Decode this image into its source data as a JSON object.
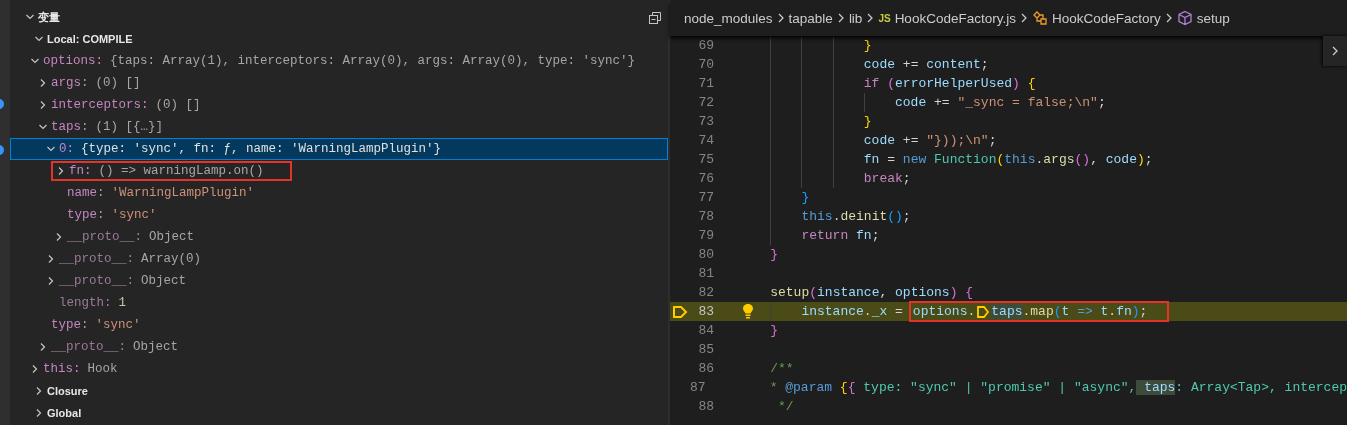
{
  "variables": {
    "tree": [
      {
        "kind": "section",
        "label": "变量",
        "expanded": true,
        "children": [
          {
            "kind": "scope",
            "label": "Local: COMPILE",
            "expanded": true,
            "children": [
              {
                "kind": "object",
                "name": "options:",
                "value": "{taps: Array(1), interceptors: Array(0), args: Array(0), type: 'sync'}",
                "dimmed": false,
                "expanded": true,
                "selected": false,
                "boxed": false,
                "children": [
                  {
                    "kind": "object",
                    "name": "args:",
                    "value": "(0) []",
                    "dimmed": false,
                    "expanded": false,
                    "selected": false,
                    "boxed": false
                  },
                  {
                    "kind": "object",
                    "name": "interceptors:",
                    "value": "(0) []",
                    "dimmed": false,
                    "expanded": false,
                    "selected": false,
                    "boxed": false
                  },
                  {
                    "kind": "object",
                    "name": "taps:",
                    "value": "(1) [{…}]",
                    "dimmed": false,
                    "expanded": true,
                    "selected": false,
                    "boxed": false,
                    "children": [
                      {
                        "kind": "entry",
                        "name": "0:",
                        "value": "{type: 'sync', fn: ƒ, name: 'WarningLampPlugin'}",
                        "dimmed": false,
                        "expanded": true,
                        "selected": true,
                        "boxed": false,
                        "children": [
                          {
                            "kind": "object",
                            "name": "fn:",
                            "value": "() => warningLamp.on()",
                            "dimmed": false,
                            "expanded": false,
                            "selected": false,
                            "boxed": true
                          },
                          {
                            "kind": "string",
                            "name": "name:",
                            "value": "'WarningLampPlugin'",
                            "dimmed": false,
                            "selected": false,
                            "boxed": false
                          },
                          {
                            "kind": "string",
                            "name": "type:",
                            "value": "'sync'",
                            "dimmed": false,
                            "selected": false,
                            "boxed": false
                          },
                          {
                            "kind": "object",
                            "name": "__proto__:",
                            "value": "Object",
                            "dimmed": true,
                            "expanded": false,
                            "selected": false,
                            "boxed": false
                          }
                        ]
                      },
                      {
                        "kind": "object",
                        "name": "__proto__:",
                        "value": "Array(0)",
                        "dimmed": true,
                        "expanded": false,
                        "selected": false,
                        "boxed": false
                      },
                      {
                        "kind": "object",
                        "name": "__proto__:",
                        "value": "Object",
                        "dimmed": true,
                        "expanded": false,
                        "selected": false,
                        "boxed": false
                      },
                      {
                        "kind": "number",
                        "name": "length:",
                        "value": "1",
                        "dimmed": true,
                        "selected": false,
                        "boxed": false
                      }
                    ]
                  },
                  {
                    "kind": "string",
                    "name": "type:",
                    "value": "'sync'",
                    "dimmed": false,
                    "selected": false,
                    "boxed": false
                  },
                  {
                    "kind": "object",
                    "name": "__proto__:",
                    "value": "Object",
                    "dimmed": true,
                    "expanded": false,
                    "selected": false,
                    "boxed": false
                  }
                ]
              },
              {
                "kind": "object",
                "name": "this:",
                "value": "Hook",
                "dimmed": false,
                "expanded": false,
                "selected": false,
                "boxed": false
              }
            ]
          },
          {
            "kind": "scope",
            "label": "Closure",
            "expanded": false
          },
          {
            "kind": "scope",
            "label": "Global",
            "expanded": false
          }
        ]
      }
    ]
  },
  "editor": {
    "breadcrumb": [
      {
        "kind": "folder",
        "label": "node_modules"
      },
      {
        "kind": "folder",
        "label": "tapable"
      },
      {
        "kind": "folder",
        "label": "lib"
      },
      {
        "kind": "file",
        "badge": "JS",
        "label": "HookCodeFactory.js"
      },
      {
        "kind": "class",
        "label": "HookCodeFactory"
      },
      {
        "kind": "method",
        "label": "setup"
      }
    ],
    "lines": [
      {
        "number": "69",
        "current": false,
        "tokens": [
          {
            "kind": "br1",
            "t": "                }"
          }
        ]
      },
      {
        "number": "70",
        "current": false,
        "tokens": [
          {
            "kind": "var",
            "t": "                code"
          },
          {
            "kind": "punc",
            "t": " += "
          },
          {
            "kind": "var",
            "t": "content"
          },
          {
            "kind": "punc",
            "t": ";"
          }
        ]
      },
      {
        "number": "71",
        "current": false,
        "tokens": [
          {
            "kind": "kw",
            "t": "                if"
          },
          {
            "kind": "br2",
            "t": " ("
          },
          {
            "kind": "var",
            "t": "errorHelperUsed"
          },
          {
            "kind": "br2",
            "t": ")"
          },
          {
            "kind": "br1",
            "t": " {"
          }
        ]
      },
      {
        "number": "72",
        "current": false,
        "tokens": [
          {
            "kind": "var",
            "t": "                    code"
          },
          {
            "kind": "punc",
            "t": " += "
          },
          {
            "kind": "str",
            "t": "\"_sync = false;\\n\""
          },
          {
            "kind": "punc",
            "t": ";"
          }
        ]
      },
      {
        "number": "73",
        "current": false,
        "tokens": [
          {
            "kind": "br1",
            "t": "                }"
          }
        ]
      },
      {
        "number": "74",
        "current": false,
        "tokens": [
          {
            "kind": "var",
            "t": "                code"
          },
          {
            "kind": "punc",
            "t": " += "
          },
          {
            "kind": "str",
            "t": "\"}));\\n\""
          },
          {
            "kind": "punc",
            "t": ";"
          }
        ]
      },
      {
        "number": "75",
        "current": false,
        "tokens": [
          {
            "kind": "var",
            "t": "                fn"
          },
          {
            "kind": "punc",
            "t": " = "
          },
          {
            "kind": "this",
            "t": "new"
          },
          {
            "kind": "cls",
            "t": " Function"
          },
          {
            "kind": "br1",
            "t": "("
          },
          {
            "kind": "this",
            "t": "this"
          },
          {
            "kind": "punc",
            "t": "."
          },
          {
            "kind": "fn",
            "t": "args"
          },
          {
            "kind": "br2",
            "t": "()"
          },
          {
            "kind": "punc",
            "t": ", "
          },
          {
            "kind": "var",
            "t": "code"
          },
          {
            "kind": "br1",
            "t": ")"
          },
          {
            "kind": "punc",
            "t": ";"
          }
        ]
      },
      {
        "number": "76",
        "current": false,
        "tokens": [
          {
            "kind": "kw",
            "t": "                break"
          },
          {
            "kind": "punc",
            "t": ";"
          }
        ]
      },
      {
        "number": "77",
        "current": false,
        "tokens": [
          {
            "kind": "br3",
            "t": "        }"
          }
        ]
      },
      {
        "number": "78",
        "current": false,
        "tokens": [
          {
            "kind": "this",
            "t": "        this"
          },
          {
            "kind": "punc",
            "t": "."
          },
          {
            "kind": "fn",
            "t": "deinit"
          },
          {
            "kind": "br3",
            "t": "()"
          },
          {
            "kind": "punc",
            "t": ";"
          }
        ]
      },
      {
        "number": "79",
        "current": false,
        "tokens": [
          {
            "kind": "kw",
            "t": "        return"
          },
          {
            "kind": "var",
            "t": " fn"
          },
          {
            "kind": "punc",
            "t": ";"
          }
        ]
      },
      {
        "number": "80",
        "current": false,
        "tokens": [
          {
            "kind": "br2",
            "t": "    }"
          }
        ]
      },
      {
        "number": "81",
        "current": false
      },
      {
        "number": "82",
        "current": false,
        "tokens": [
          {
            "kind": "fn",
            "t": "    setup"
          },
          {
            "kind": "br2",
            "t": "("
          },
          {
            "kind": "var",
            "t": "instance"
          },
          {
            "kind": "punc",
            "t": ", "
          },
          {
            "kind": "var",
            "t": "options"
          },
          {
            "kind": "br2",
            "t": ")"
          },
          {
            "kind": "br2",
            "t": " {"
          }
        ]
      },
      {
        "number": "83",
        "current": true,
        "tokens": [
          {
            "kind": "var",
            "t": "        instance"
          },
          {
            "kind": "punc",
            "t": "."
          },
          {
            "kind": "var",
            "t": "_x"
          },
          {
            "kind": "punc",
            "t": " ="
          }
        ],
        "boxed_tokens": [
          {
            "kind": "var",
            "t": "options"
          },
          {
            "kind": "punc",
            "t": "."
          },
          {
            "kind": "stop"
          },
          {
            "kind": "hl",
            "t": "taps"
          },
          {
            "kind": "punc",
            "t": "."
          },
          {
            "kind": "fn",
            "t": "map"
          },
          {
            "kind": "br3",
            "t": "("
          },
          {
            "kind": "var",
            "t": "t"
          },
          {
            "kind": "this",
            "t": " =>"
          },
          {
            "kind": "var",
            "t": " t"
          },
          {
            "kind": "punc",
            "t": "."
          },
          {
            "kind": "var",
            "t": "fn"
          },
          {
            "kind": "br3",
            "t": ")"
          },
          {
            "kind": "punc",
            "t": ";"
          }
        ]
      },
      {
        "number": "84",
        "current": false,
        "tokens": [
          {
            "kind": "br2",
            "t": "    }"
          }
        ]
      },
      {
        "number": "85",
        "current": false
      },
      {
        "number": "86",
        "current": false,
        "tokens": [
          {
            "kind": "cmt",
            "t": "    /**"
          }
        ]
      },
      {
        "number": "87",
        "current": false,
        "tokens": [
          {
            "kind": "cmt",
            "t": "     *"
          },
          {
            "kind": "tag",
            "t": " @param"
          },
          {
            "kind": "br1",
            "t": " {"
          },
          {
            "kind": "br2",
            "t": "{"
          },
          {
            "kind": "cls",
            "t": " type: \"sync\" | \"promise\" | \"async\","
          },
          {
            "kind": "hl",
            "t": " taps"
          },
          {
            "kind": "cls",
            "t": ": Array<Tap>, intercep"
          }
        ]
      },
      {
        "number": "88",
        "current": false,
        "tokens": [
          {
            "kind": "cmt",
            "t": "     */"
          }
        ]
      }
    ]
  }
}
